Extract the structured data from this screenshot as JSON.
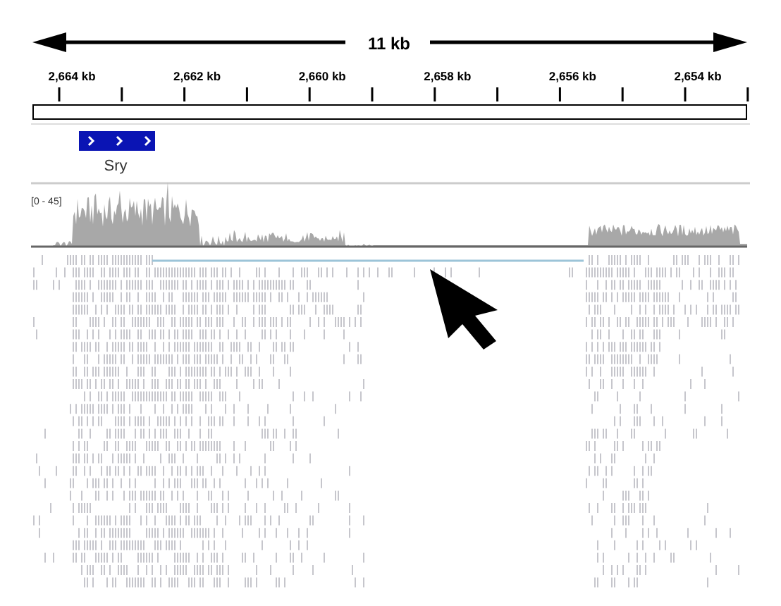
{
  "scale": {
    "label": "11 kb"
  },
  "ruler": {
    "tick_labels": [
      "2,664 kb",
      "2,662 kb",
      "2,660 kb",
      "2,658 kb",
      "2,656 kb",
      "2,654 kb"
    ]
  },
  "gene_track": {
    "features": [
      {
        "name": "Sry"
      }
    ]
  },
  "coverage_track": {
    "range": "[0 - 45]"
  }
}
